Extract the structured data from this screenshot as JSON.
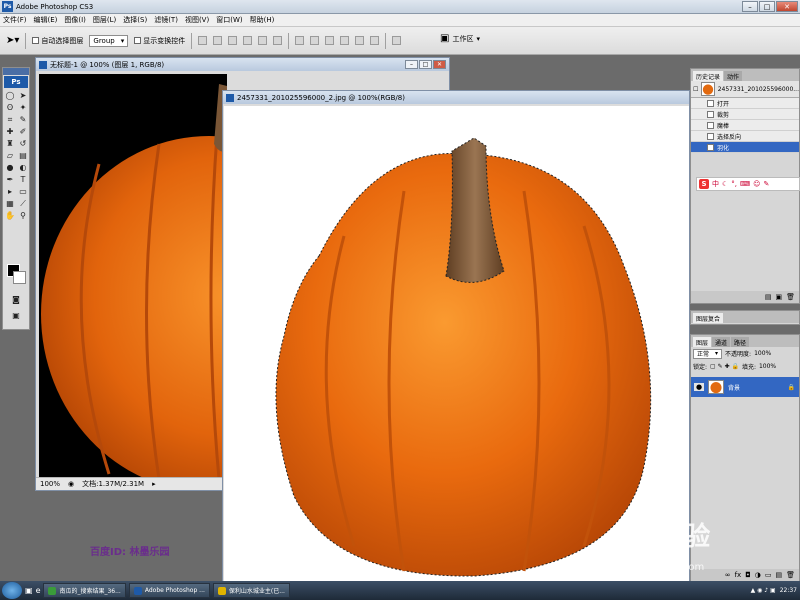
{
  "app": {
    "title": "Adobe Photoshop CS3"
  },
  "menu": [
    "文件(F)",
    "编辑(E)",
    "图像(I)",
    "图层(L)",
    "选择(S)",
    "滤镜(T)",
    "视图(V)",
    "窗口(W)",
    "帮助(H)"
  ],
  "options": {
    "auto_select_label": "自动选择图层",
    "auto_select_value": "Group",
    "show_transform_label": "显示变换控件",
    "workspace_label": "工作区"
  },
  "doc1": {
    "title": "无标题-1 @ 100% (图层 1, RGB/8)",
    "zoom": "100%",
    "doc_size": "文档:1.37M/2.31M"
  },
  "doc2": {
    "title": "2457331_201025596000_2.jpg @ 100%(RGB/8)"
  },
  "history_panel": {
    "tabs": [
      "历史记录",
      "动作"
    ],
    "snapshot": "2457331_201025596000...",
    "items": [
      "打开",
      "裁剪",
      "魔棒",
      "选择反向",
      "羽化"
    ],
    "selected_index": 4
  },
  "navigator_panel": {
    "tabs": [
      "图层复合"
    ]
  },
  "layers_panel": {
    "tabs": [
      "图层",
      "通道",
      "路径"
    ],
    "blend_mode": "正常",
    "opacity_label": "不透明度:",
    "opacity_value": "100%",
    "lock_label": "锁定:",
    "fill_label": "填充:",
    "fill_value": "100%",
    "layer_name": "背景"
  },
  "ime_bar": {
    "logo": "S",
    "mode": "中"
  },
  "watermark": {
    "baidu_id": "百度ID: 林墨乐园",
    "brand": "Bai经验",
    "url": "jingyan.baidu.com"
  },
  "taskbar": {
    "items": [
      "南瓜的_搜索结果_36...",
      "Adobe Photoshop ...",
      "保利山水城业主(已..."
    ],
    "clock": "22:37"
  }
}
